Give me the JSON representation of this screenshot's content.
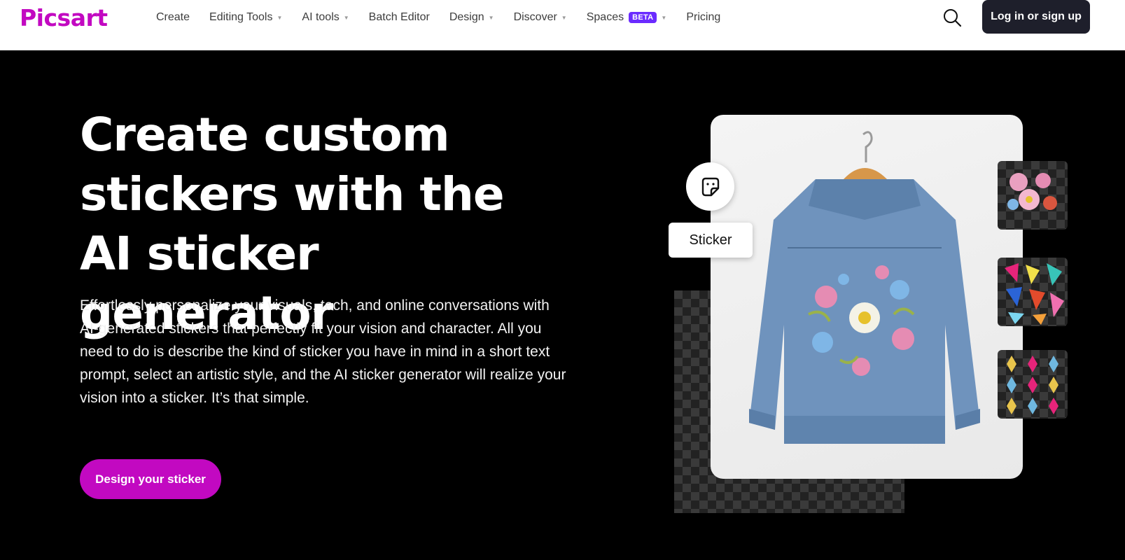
{
  "header": {
    "logo": "Picsart",
    "nav": [
      {
        "label": "Create",
        "dropdown": false
      },
      {
        "label": "Editing Tools",
        "dropdown": true
      },
      {
        "label": "AI tools",
        "dropdown": true
      },
      {
        "label": "Batch Editor",
        "dropdown": false
      },
      {
        "label": "Design",
        "dropdown": true
      },
      {
        "label": "Discover",
        "dropdown": true
      },
      {
        "label": "Spaces",
        "dropdown": true,
        "badge": "BETA"
      },
      {
        "label": "Pricing",
        "dropdown": false
      }
    ],
    "search_icon": "search-icon",
    "login_label": "Log in or sign up"
  },
  "hero": {
    "title": "Create custom stickers with the AI sticker generator",
    "description": "Effortlessly personalize your visuals, tech, and online conversations with AI-generated stickers that perfectly fit your vision and character. All you need to do is describe the kind of sticker you have in mind in a short text prompt, select an artistic style, and the AI sticker generator will realize your vision into a sticker. It’s that simple.",
    "cta_label": "Design your sticker"
  },
  "visual": {
    "sticker_label": "Sticker",
    "sticker_icon": "sticker-icon"
  },
  "colors": {
    "brand": "#c209c1",
    "dark_button": "#1e1f2b",
    "beta_badge": "#6b2bff",
    "hero_bg": "#000000"
  }
}
